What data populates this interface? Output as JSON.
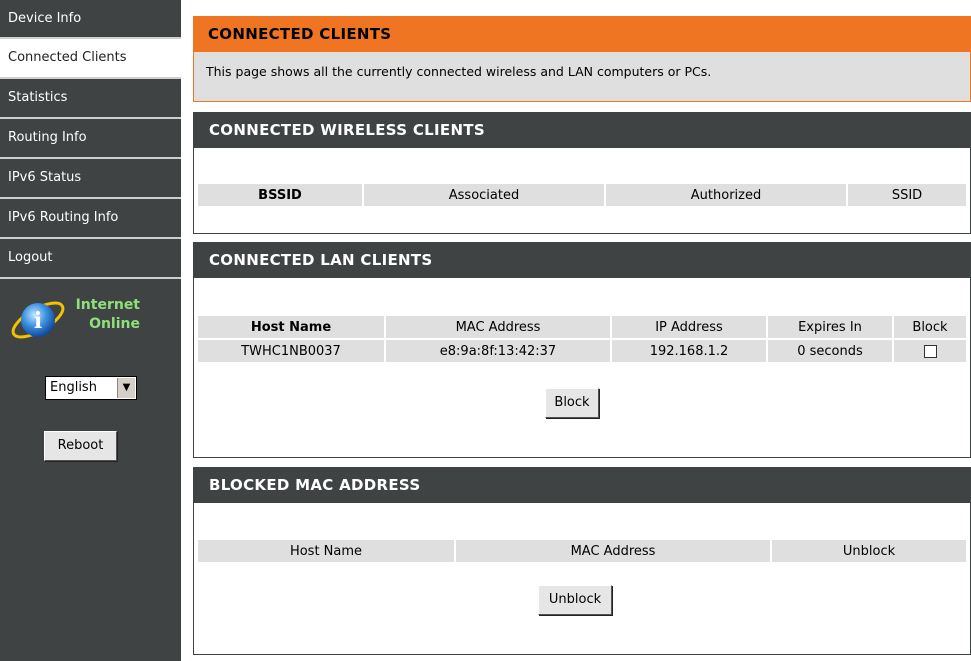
{
  "sidebar": {
    "items": [
      {
        "label": "Device Info"
      },
      {
        "label": "Connected Clients"
      },
      {
        "label": "Statistics"
      },
      {
        "label": "Routing Info"
      },
      {
        "label": "IPv6 Status"
      },
      {
        "label": "IPv6 Routing Info"
      },
      {
        "label": "Logout"
      }
    ],
    "active_index": 1,
    "status_line1": "Internet",
    "status_line2": "Online",
    "language": "English",
    "reboot_label": "Reboot"
  },
  "intro": {
    "title": "CONNECTED CLIENTS",
    "description": "This page shows all the currently connected wireless and LAN computers or PCs."
  },
  "wireless": {
    "title": "CONNECTED WIRELESS CLIENTS",
    "columns": [
      "BSSID",
      "Associated",
      "Authorized",
      "SSID"
    ]
  },
  "lan": {
    "title": "CONNECTED LAN CLIENTS",
    "columns": [
      "Host Name",
      "MAC Address",
      "IP Address",
      "Expires In",
      "Block"
    ],
    "rows": [
      {
        "host": "TWHC1NB0037",
        "mac": "e8:9a:8f:13:42:37",
        "ip": "192.168.1.2",
        "expires": "0 seconds",
        "blocked": false
      }
    ],
    "block_button": "Block"
  },
  "blocked": {
    "title": "BLOCKED MAC ADDRESS",
    "columns": [
      "Host Name",
      "MAC Address",
      "Unblock"
    ],
    "unblock_button": "Unblock"
  },
  "colors": {
    "sidebar_bg": "#404343",
    "accent_orange": "#f07522",
    "status_green": "#8fe07a",
    "table_cell_bg": "#dfdfdf"
  }
}
